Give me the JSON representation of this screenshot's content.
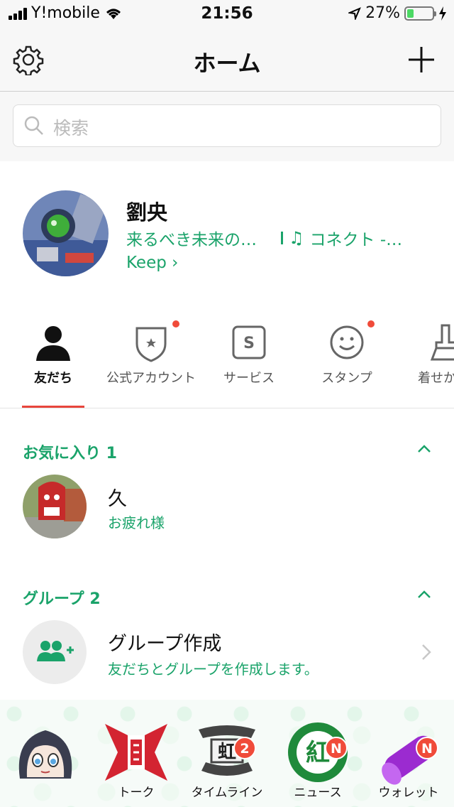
{
  "status_bar": {
    "carrier": "Y!mobile",
    "time": "21:56",
    "battery_percent": "27%",
    "battery_level": 0.27
  },
  "nav": {
    "title": "ホーム"
  },
  "search": {
    "placeholder": "検索"
  },
  "profile": {
    "name": "劉央",
    "status_message": "来るべき未来の…",
    "music": "コネクト -…",
    "keep_label": "Keep"
  },
  "tabs": [
    {
      "label": "友だち",
      "icon": "person-icon",
      "active": true,
      "dot": false
    },
    {
      "label": "公式アカウント",
      "icon": "shield-star-icon",
      "active": false,
      "dot": true
    },
    {
      "label": "サービス",
      "icon": "service-s-icon",
      "active": false,
      "dot": false
    },
    {
      "label": "スタンプ",
      "icon": "smiley-icon",
      "active": false,
      "dot": true
    },
    {
      "label": "着せか",
      "icon": "brush-icon",
      "active": false,
      "dot": false
    }
  ],
  "favorites": {
    "title": "お気に入り 1",
    "items": [
      {
        "name": "久",
        "message": "お疲れ様"
      }
    ]
  },
  "groups": {
    "title": "グループ 2",
    "create": {
      "name": "グループ作成",
      "message": "友だちとグループを作成します。"
    }
  },
  "bottom_nav": [
    {
      "label": "",
      "icon": "home-character-icon",
      "badge": ""
    },
    {
      "label": "トーク",
      "icon": "talk-emblem-icon",
      "badge": ""
    },
    {
      "label": "タイムライン",
      "icon": "timeline-emblem-icon",
      "badge": "2"
    },
    {
      "label": "ニュース",
      "icon": "news-emblem-icon",
      "badge": "N"
    },
    {
      "label": "ウォレット",
      "icon": "wallet-emblem-icon",
      "badge": "N"
    }
  ],
  "colors": {
    "accent_green": "#1aa36a",
    "badge_red": "#f04b3a",
    "tab_underline": "#e8453c"
  }
}
